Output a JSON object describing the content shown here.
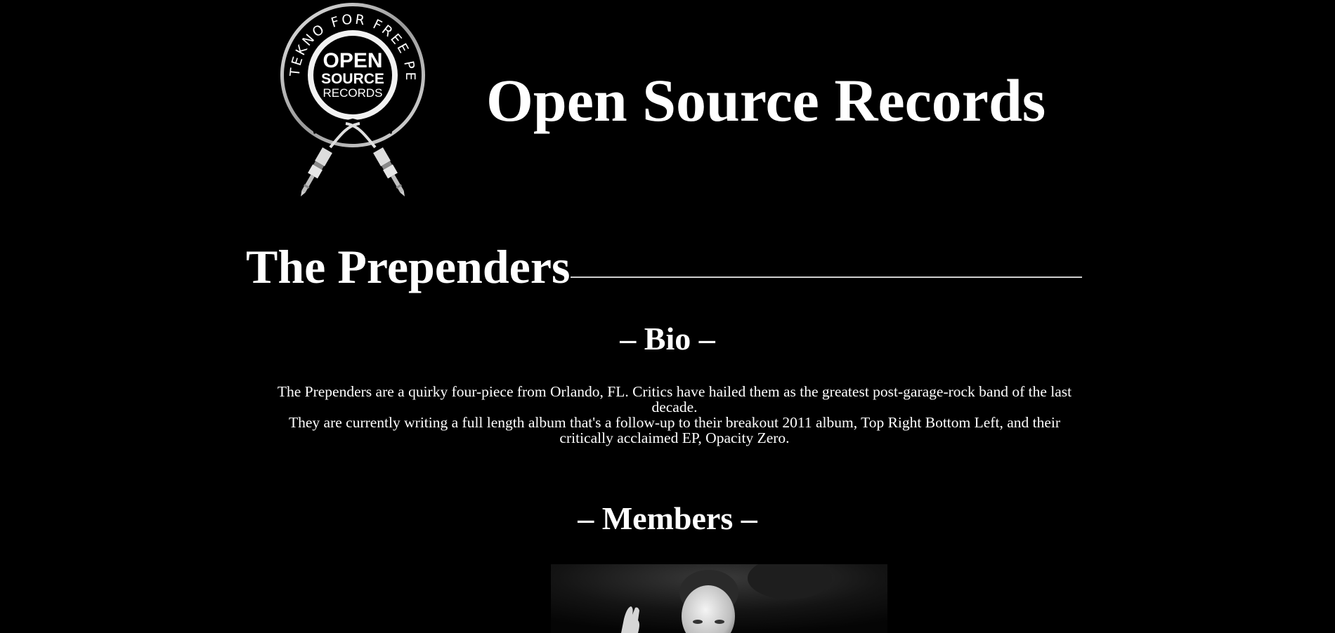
{
  "site": {
    "title": "Open Source Records",
    "logo": {
      "arc_text": "FREE TEKNO FOR FREE PEOPLE",
      "line1": "OPEN",
      "line2": "SOURCE",
      "line3": "RECORDS"
    }
  },
  "band": {
    "name": "The Prependers"
  },
  "bio": {
    "heading": "– Bio –",
    "paragraphs": [
      "The Prependers are a quirky four-piece from Orlando, FL. Critics have hailed them as the greatest post-garage-rock band of the last decade.",
      "They are currently writing a full length album that's a follow-up to their breakout 2011 album, Top Right Bottom Left, and their critically acclaimed EP, Opacity Zero."
    ]
  },
  "members": {
    "heading": "– Members –"
  },
  "colors": {
    "background": "#000000",
    "text": "#ffffff",
    "rule": "#cfcfcf"
  }
}
